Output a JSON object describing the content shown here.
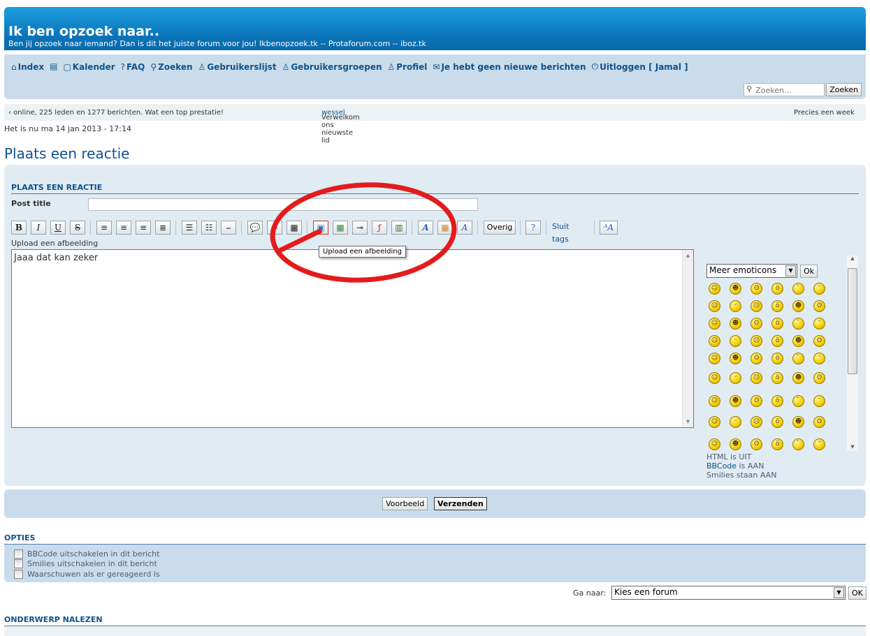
{
  "header": {
    "title": "Ik ben opzoek naar..",
    "description": "Ben jij opzoek naar iemand? Dan is dit het juiste forum voor jou! Ikbenopzoek.tk -- Protaforum.com -- iboz.tk"
  },
  "nav": {
    "index": "Index",
    "kalender": "Kalender",
    "faq": "FAQ",
    "zoeken": "Zoeken",
    "gebruikerslijst": "Gebruikerslijst",
    "gebruikersgroepen": "Gebruikersgroepen",
    "profiel": "Profiel",
    "berichten": "Je hebt geen nieuwe berichten",
    "uitloggen": "Uitloggen [ Jamal ]"
  },
  "search": {
    "placeholder": "Zoeken...",
    "button": "Zoeken"
  },
  "ticker": {
    "left": "‹ online, 225 leden en 1277 berichten. Wat een top prestatie!",
    "middle_prefix": "Verwelkom ons nieuwste lid ",
    "middle_user": "wessel",
    "right": "Precies een week"
  },
  "date": "Het is nu ma 14 jan 2013 - 17:14",
  "page_title": "Plaats een reactie",
  "form": {
    "section_title": "PLAATS EEN REACTIE",
    "post_title_label": "Post title",
    "post_title_value": "",
    "upload_hint": "Upload een afbeelding",
    "message": "Jaaa dat kan zeker",
    "tooltip": "Upload een afbeelding"
  },
  "toolbar": {
    "bold": "B",
    "italic": "I",
    "underline": "U",
    "strike": "S",
    "overig": "Overig",
    "sluit_tags": "Sluit tags"
  },
  "emoticons": {
    "select": "Meer emoticons",
    "ok": "Ok"
  },
  "status": {
    "html_label": "HTML is UIT",
    "bbcode_link": "BBCode",
    "bbcode_rest": " is AAN",
    "smilies": "Smilies staan AAN"
  },
  "submit": {
    "preview": "Voorbeeld",
    "send": "Verzenden"
  },
  "options": {
    "title": "OPTIES",
    "items": [
      "BBCode uitschakelen in dit bericht",
      "Smilies uitschakelen in dit bericht",
      "Waarschuwen als er gereageerd is"
    ]
  },
  "goto": {
    "label": "Ga naar:",
    "select": "Kies een forum",
    "ok": "OK"
  },
  "review": {
    "title": "ONDERWERP NALEZEN"
  },
  "colors": {
    "accent": "#105289",
    "header": "#0a73b8",
    "annotation": "#e31b1b"
  }
}
